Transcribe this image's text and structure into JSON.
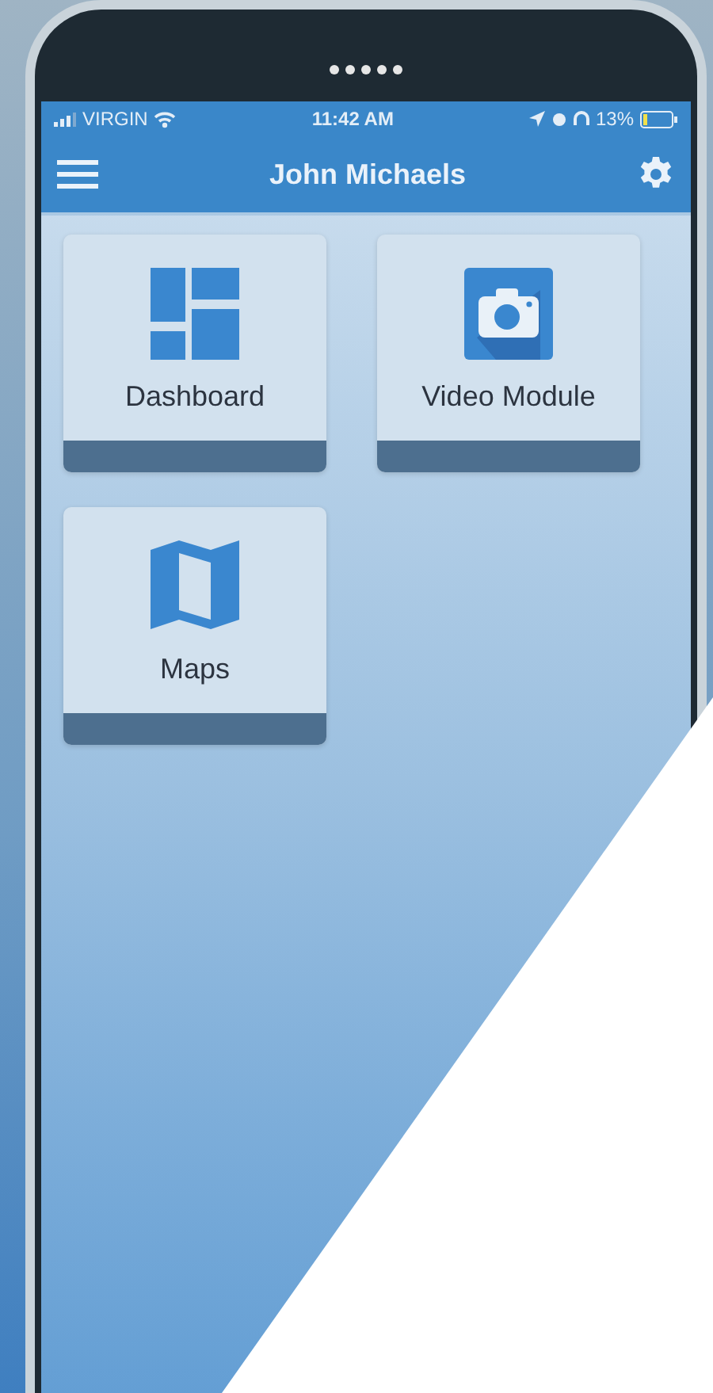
{
  "status_bar": {
    "carrier": "VIRGIN",
    "time": "11:42 AM",
    "battery": "13%"
  },
  "header": {
    "title": "John Michaels"
  },
  "tiles": [
    {
      "label": "Dashboard",
      "kind": "dashboard"
    },
    {
      "label": "Video Module",
      "kind": "camera"
    },
    {
      "label": "Maps",
      "kind": "map"
    }
  ]
}
